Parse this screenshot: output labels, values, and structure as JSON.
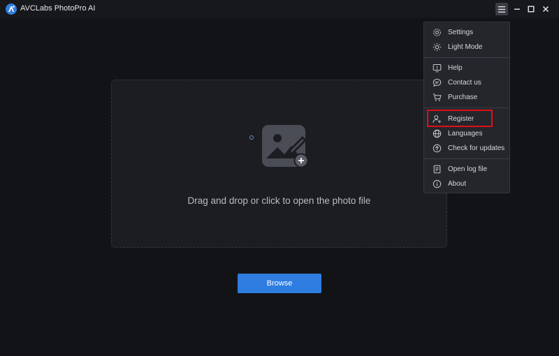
{
  "window": {
    "title": "AVCLabs PhotoPro AI"
  },
  "main": {
    "drop_text": "Drag and drop or click to open the photo file",
    "browse_label": "Browse"
  },
  "menu": {
    "items": [
      {
        "label": "Settings",
        "icon": "gear-icon"
      },
      {
        "label": "Light Mode",
        "icon": "sun-icon"
      },
      {
        "label": "Help",
        "icon": "help-monitor-icon"
      },
      {
        "label": "Contact us",
        "icon": "chat-bubble-icon"
      },
      {
        "label": "Purchase",
        "icon": "cart-icon"
      },
      {
        "label": "Register",
        "icon": "user-plus-icon"
      },
      {
        "label": "Languages",
        "icon": "globe-icon"
      },
      {
        "label": "Check for updates",
        "icon": "update-arrow-icon"
      },
      {
        "label": "Open log file",
        "icon": "document-icon"
      },
      {
        "label": "About",
        "icon": "info-icon"
      }
    ]
  },
  "colors": {
    "accent": "#2f7de1",
    "background": "#121316",
    "highlight_border": "#e0101a"
  }
}
